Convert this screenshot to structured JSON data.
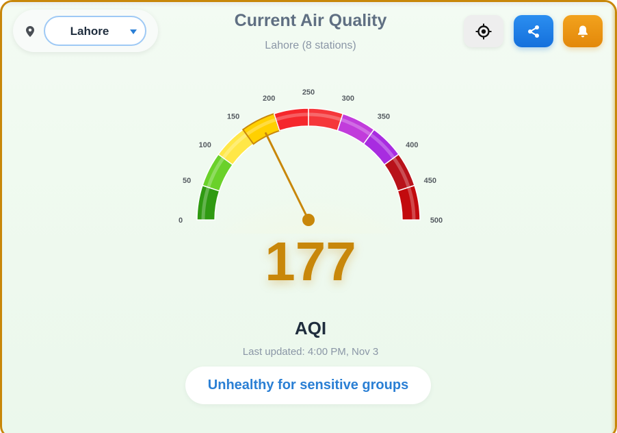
{
  "location": {
    "selected": "Lahore"
  },
  "header": {
    "title": "Current Air Quality",
    "subtitle": "Lahore (8 stations)"
  },
  "icons": {
    "pin": "map-pin-icon",
    "chevron": "chevron-down-icon",
    "locate": "crosshair-icon",
    "share": "share-icon",
    "alert": "bell-icon"
  },
  "colors": {
    "accent": "#c8870a",
    "share_button": "#1570dc",
    "alert_button": "#e3880a",
    "status_text": "#2a7fd4"
  },
  "gauge": {
    "min": 0,
    "max": 500,
    "value": 177,
    "ticks": [
      "0",
      "50",
      "100",
      "150",
      "200",
      "250",
      "300",
      "350",
      "400",
      "450",
      "500"
    ],
    "bands": [
      {
        "from": 0,
        "to": 50,
        "color": "#2f9a12"
      },
      {
        "from": 50,
        "to": 100,
        "color": "#6ad12a"
      },
      {
        "from": 100,
        "to": 150,
        "color": "#ffe747"
      },
      {
        "from": 150,
        "to": 200,
        "color": "#ffd000"
      },
      {
        "from": 200,
        "to": 250,
        "color": "#f5272c"
      },
      {
        "from": 250,
        "to": 300,
        "color": "#f5373a"
      },
      {
        "from": 300,
        "to": 350,
        "color": "#c13cdb"
      },
      {
        "from": 350,
        "to": 400,
        "color": "#a82ce0"
      },
      {
        "from": 400,
        "to": 450,
        "color": "#b8121a"
      },
      {
        "from": 450,
        "to": 500,
        "color": "#c20a0e"
      }
    ]
  },
  "aqi": {
    "value": "177",
    "label": "AQI",
    "last_updated": "Last updated: 4:00 PM, Nov 3",
    "status": "Unhealthy for sensitive groups"
  }
}
